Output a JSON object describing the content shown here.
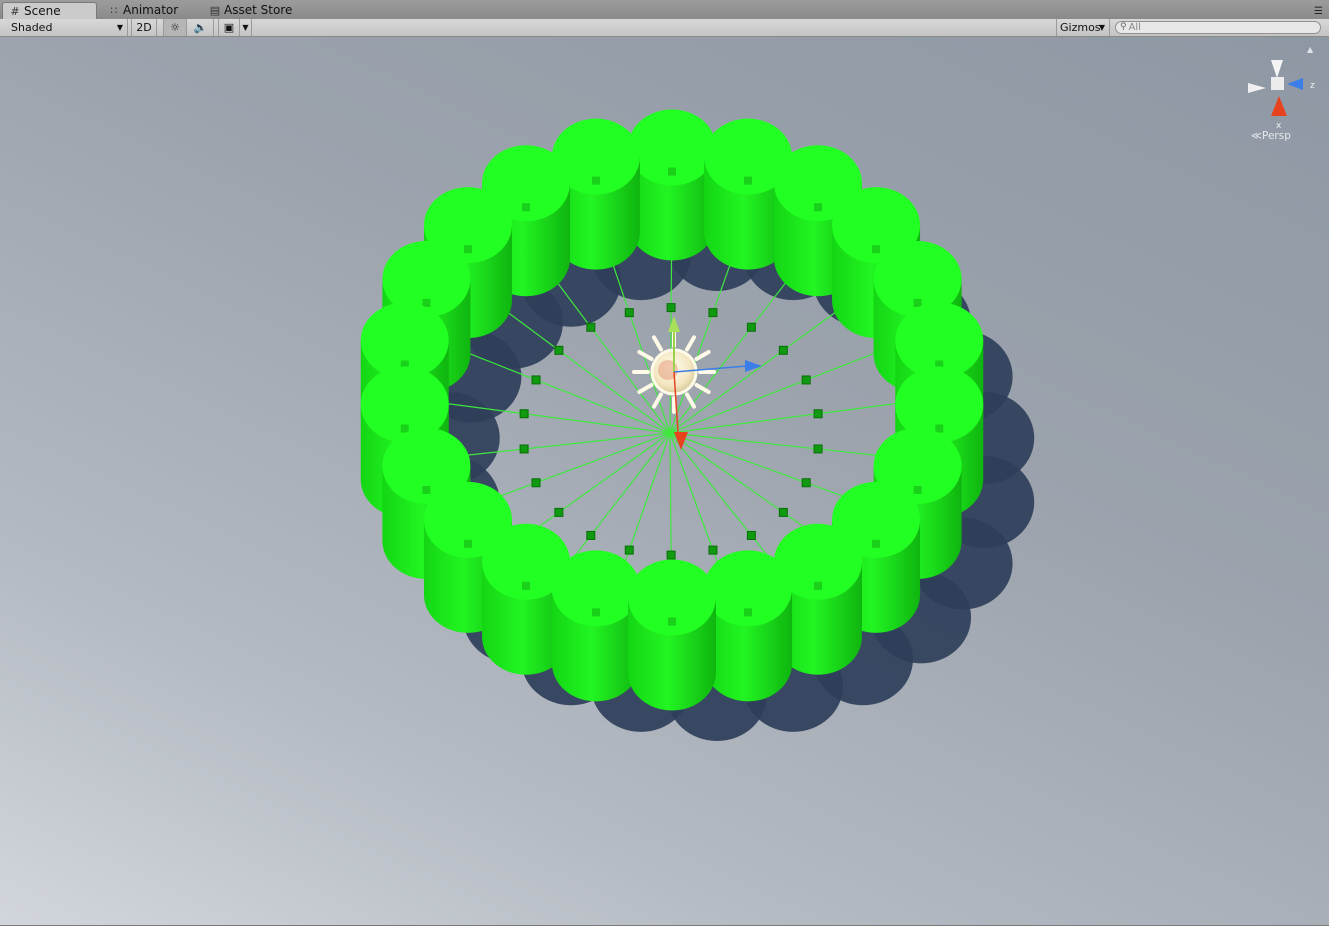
{
  "tabs": [
    {
      "label": "Scene",
      "icon": "grid-icon",
      "active": true
    },
    {
      "label": "Animator",
      "icon": "animator-icon",
      "active": false
    },
    {
      "label": "Asset Store",
      "icon": "store-bag-icon",
      "active": false
    }
  ],
  "toolbar": {
    "draw_mode": "Shaded",
    "mode_2d": "2D",
    "lighting_icon": "sun-icon",
    "audio_icon": "speaker-icon",
    "effects_icon": "image-icon",
    "gizmos_label": "Gizmos",
    "search_placeholder": "All"
  },
  "scene_gizmo": {
    "projection_label": "Persp",
    "axis_z": "z",
    "axis_x": "x",
    "colors": {
      "x": "#e8431f",
      "y": "#9ad24a",
      "z": "#3c7ee8"
    }
  },
  "scene": {
    "object_color": "#22ff22",
    "ring_cylinder_count": 22,
    "background": "#9ca3ad",
    "selected_light": "directional-light"
  }
}
